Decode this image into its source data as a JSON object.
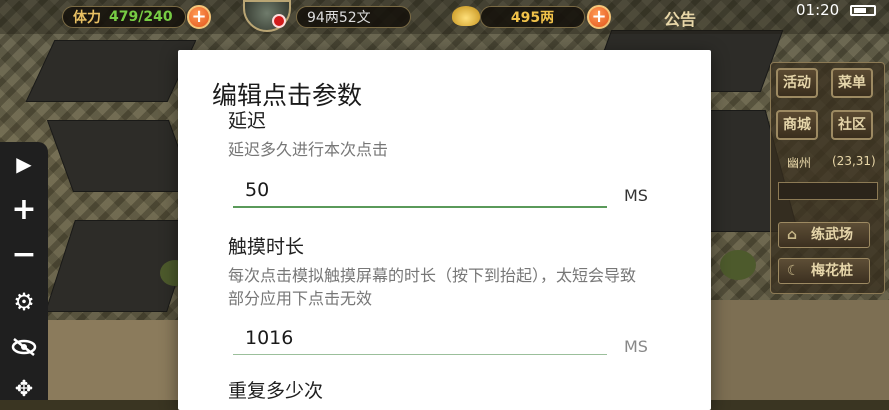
{
  "topbar": {
    "stamina_label": "体力",
    "stamina_value": "479/240",
    "silver_value": "94两52文",
    "gold_value": "495两",
    "notice_label": "公告",
    "clock": "01:20"
  },
  "right_menu": {
    "buttons": [
      "活动",
      "菜单",
      "商城",
      "社区"
    ],
    "location_name": "幽州",
    "location_coords": "(23,31)",
    "places": [
      "练武场",
      "梅花桩"
    ]
  },
  "dialog": {
    "title": "编辑点击参数",
    "delay_label": "延迟",
    "delay_desc": "延迟多久进行本次点击",
    "delay_value": "50",
    "delay_unit": "MS",
    "touch_label": "触摸时长",
    "touch_desc": "每次点击模拟触摸屏幕的时长（按下到抬起），太短会导致部分应用下点击无效",
    "touch_value": "1016",
    "touch_unit": "MS",
    "repeat_label": "重复多少次"
  },
  "colors": {
    "accent_green": "#5a9a5a",
    "inactive_line": "#9bbf9b",
    "toolbar_bg": "#1f1f1f",
    "dialog_bg": "#ffffff"
  },
  "icons": [
    "play-icon",
    "plus-icon",
    "minus-icon",
    "gear-icon",
    "eye-off-icon",
    "move-icon"
  ]
}
